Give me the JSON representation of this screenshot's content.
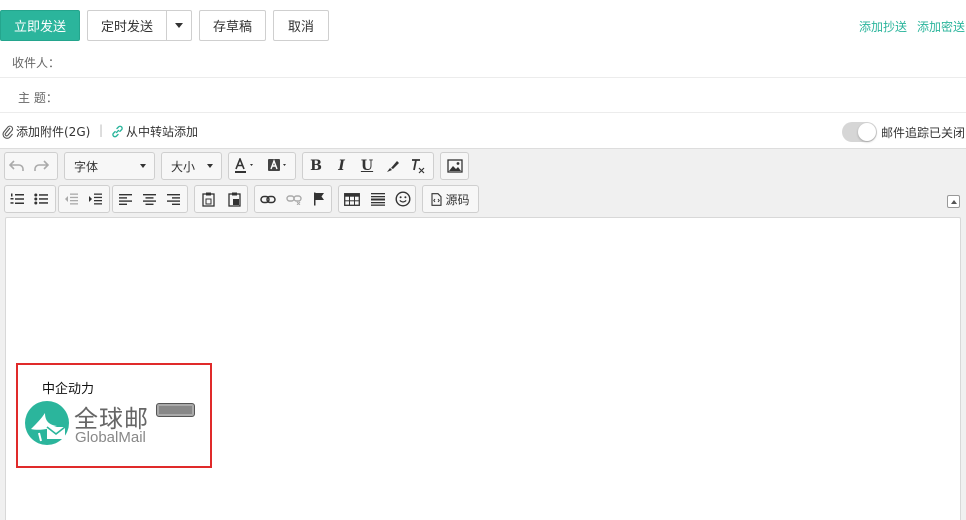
{
  "actions": {
    "send": "立即发送",
    "timed_send": "定时发送",
    "save_draft": "存草稿",
    "cancel": "取消",
    "add_cc": "添加抄送",
    "add_bcc": "添加密送"
  },
  "fields": {
    "recipient_label": "收件人：",
    "subject_label": "主  题："
  },
  "attachments": {
    "add_attachment": "添加附件(2G)",
    "separator": "|",
    "from_transfer": "从中转站添加",
    "tracking_label": "邮件追踪已关闭",
    "tracking_on": false
  },
  "toolbar": {
    "font_family": "字体",
    "font_size": "大小",
    "source": "源码",
    "icons_row1": [
      "undo-icon",
      "redo-icon",
      "font-color-icon",
      "highlight-color-icon",
      "bold-icon",
      "italic-icon",
      "underline-icon",
      "format-painter-icon",
      "clear-format-icon",
      "insert-image-icon"
    ],
    "icons_row2": [
      "ordered-list-icon",
      "unordered-list-icon",
      "outdent-icon",
      "indent-icon",
      "align-left-icon",
      "align-center-icon",
      "align-right-icon",
      "paste-icon",
      "paste-plain-icon",
      "link-icon",
      "unlink-icon",
      "anchor-flag-icon",
      "table-icon",
      "horizontal-rule-icon",
      "emoji-icon",
      "source-code-icon"
    ]
  },
  "signature": {
    "company": "中企动力",
    "brand_cn": "全球邮",
    "brand_en": "GlobalMail"
  },
  "colors": {
    "accent": "#2bb59c",
    "signature_border": "#e02a2a"
  }
}
